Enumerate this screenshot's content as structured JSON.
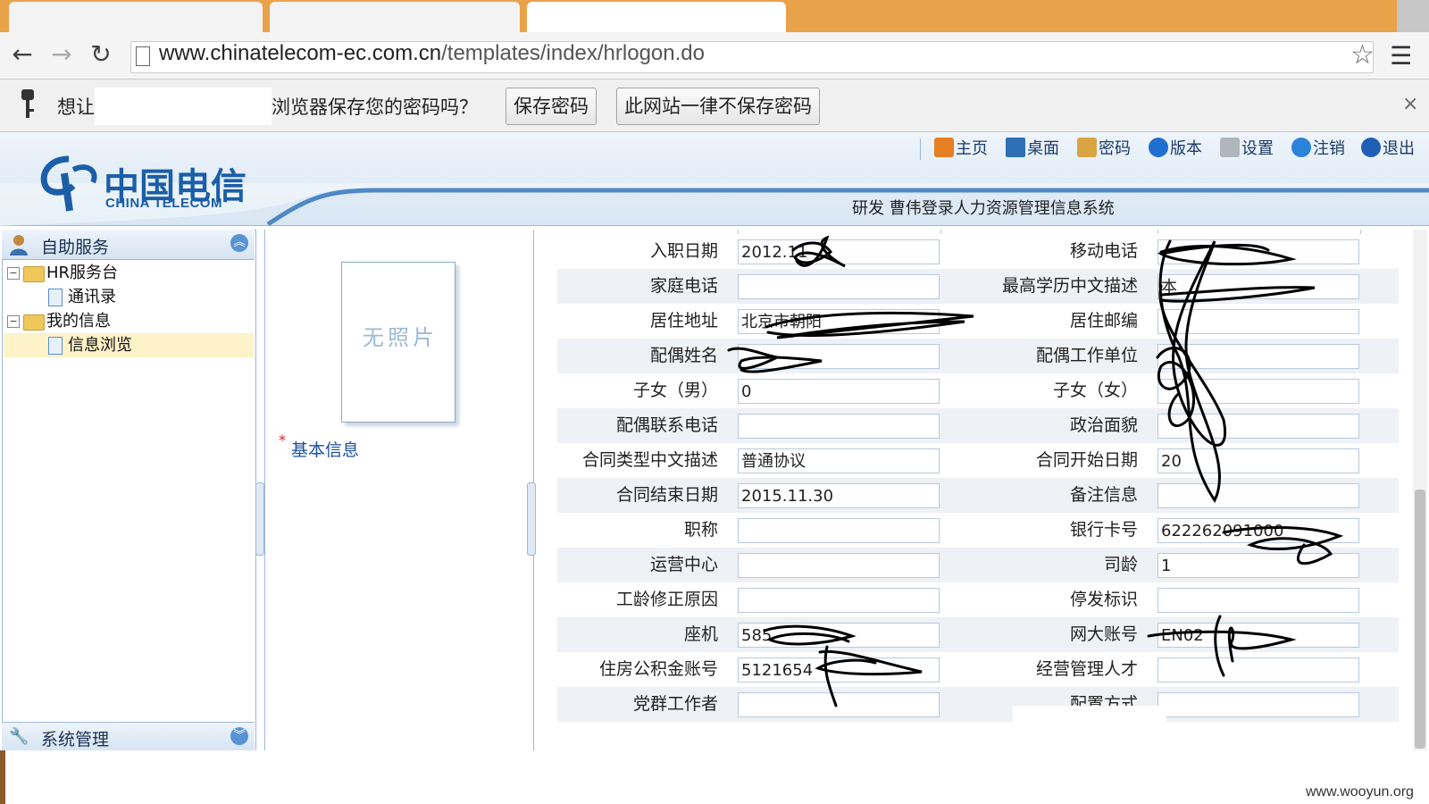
{
  "browser": {
    "url_host": "www.chinatelecom-ec.com.cn",
    "url_path": "/templates/index/hrlogon.do"
  },
  "password_bar": {
    "prompt_start": "想让",
    "prompt_end": "浏览器保存您的密码吗？",
    "save_label": "保存密码",
    "never_label": "此网站一律不保存密码",
    "close": "×"
  },
  "header": {
    "logo_cn": "中国电信",
    "logo_en": "CHINA TELECOM",
    "nav": [
      {
        "label": "主页",
        "icon": "home-icon"
      },
      {
        "label": "桌面",
        "icon": "desktop-icon"
      },
      {
        "label": "密码",
        "icon": "lock-icon"
      },
      {
        "label": "版本",
        "icon": "info-icon"
      },
      {
        "label": "设置",
        "icon": "settings-icon"
      },
      {
        "label": "注销",
        "icon": "logout-icon"
      },
      {
        "label": "退出",
        "icon": "exit-icon"
      }
    ],
    "system_title": "研发 曹伟登录人力资源管理信息系统"
  },
  "sidebar": {
    "panel_title": "自助服务",
    "bottom_panel_title": "系统管理",
    "tree": [
      {
        "label": "HR服务台",
        "type": "folder"
      },
      {
        "label": "通讯录",
        "type": "page"
      },
      {
        "label": "我的信息",
        "type": "folder"
      },
      {
        "label": "信息浏览",
        "type": "page",
        "selected": true
      }
    ]
  },
  "middle": {
    "photo_text": "无照片",
    "basic_info_link": "基本信息",
    "required_mark": "*"
  },
  "form": {
    "left": [
      {
        "label": "入职日期",
        "value": "2012.11"
      },
      {
        "label": "家庭电话",
        "value": ""
      },
      {
        "label": "居住地址",
        "value": "北京市朝阳"
      },
      {
        "label": "配偶姓名",
        "value": ""
      },
      {
        "label": "子女（男）",
        "value": "0"
      },
      {
        "label": "配偶联系电话",
        "value": ""
      },
      {
        "label": "合同类型中文描述",
        "value": "普通协议"
      },
      {
        "label": "合同结束日期",
        "value": "2015.11.30"
      },
      {
        "label": "职称",
        "value": ""
      },
      {
        "label": "运营中心",
        "value": ""
      },
      {
        "label": "工龄修正原因",
        "value": ""
      },
      {
        "label": "座机",
        "value": "585"
      },
      {
        "label": "住房公积金账号",
        "value": "5121654"
      },
      {
        "label": "党群工作者",
        "value": ""
      }
    ],
    "right": [
      {
        "label": "移动电话",
        "value": ""
      },
      {
        "label": "最高学历中文描述",
        "value": "本"
      },
      {
        "label": "居住邮编",
        "value": ""
      },
      {
        "label": "配偶工作单位",
        "value": ""
      },
      {
        "label": "子女（女）",
        "value": ""
      },
      {
        "label": "政治面貌",
        "value": ""
      },
      {
        "label": "合同开始日期",
        "value": "20"
      },
      {
        "label": "备注信息",
        "value": ""
      },
      {
        "label": "银行卡号",
        "value": "622262091000"
      },
      {
        "label": "司龄",
        "value": "1"
      },
      {
        "label": "停发标识",
        "value": ""
      },
      {
        "label": "网大账号",
        "value": "EN02"
      },
      {
        "label": "经营管理人才",
        "value": ""
      },
      {
        "label": "配置方式",
        "value": ""
      }
    ]
  },
  "watermark": "www.wooyun.org"
}
